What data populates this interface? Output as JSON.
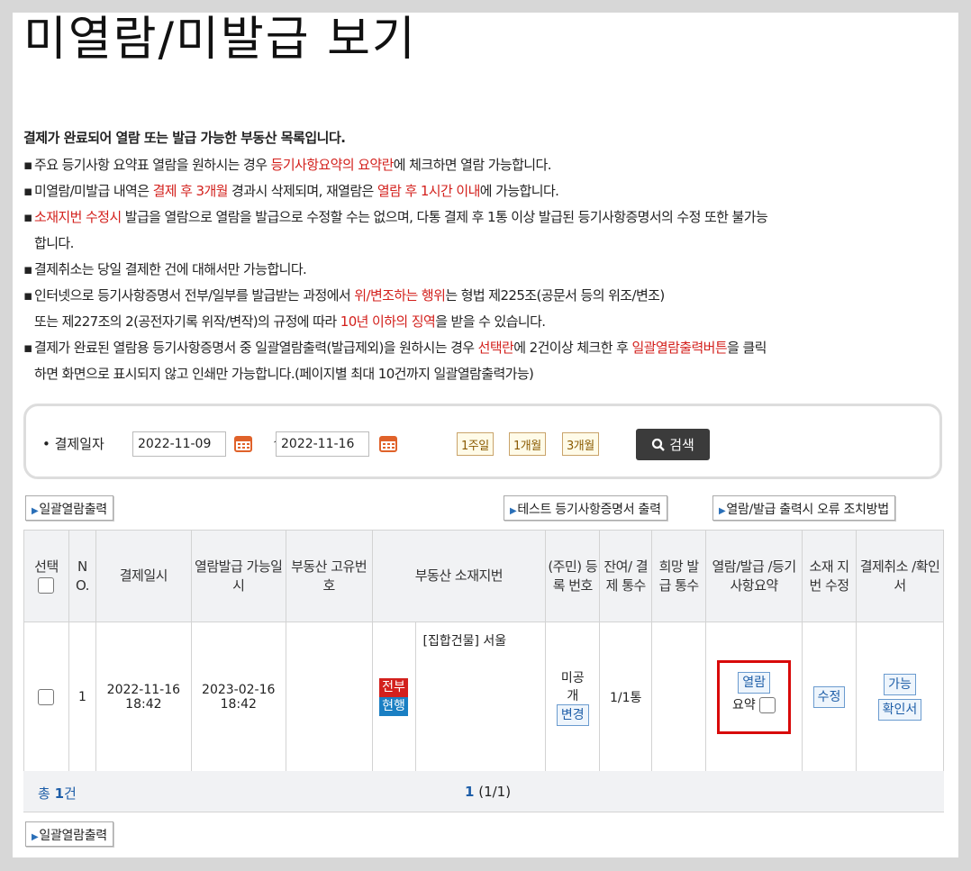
{
  "page_title": "미열람/미발급 보기",
  "notice": {
    "lead": "결제가 완료되어 열람 또는 발급 가능한 부동산 목록입니다.",
    "line1_a": "주요 등기사항 요약표 열람을 원하시는 경우 ",
    "line1_red": "등기사항요약의 요약란",
    "line1_b": "에 체크하면 열람 가능합니다.",
    "line2_a": "미열람/미발급 내역은 ",
    "line2_red1": "결제 후 3개월",
    "line2_b": " 경과시 삭제되며, 재열람은 ",
    "line2_red2": "열람 후 1시간 이내",
    "line2_c": "에 가능합니다.",
    "line3_red": "소재지번 수정시",
    "line3_b": " 발급을 열람으로 열람을 발급으로 수정할 수는 없으며, 다통 결제 후 1통 이상 발급된 등기사항증명서의 수정 또한 불가능",
    "line3_c": "합니다.",
    "line4": "결제취소는 당일 결제한 건에 대해서만 가능합니다.",
    "line5_a": "인터넷으로 등기사항증명서 전부/일부를 발급받는 과정에서 ",
    "line5_red": "위/변조하는 행위",
    "line5_b": "는 형법 제225조(공문서 등의 위조/변조)",
    "line6_a": "또는 제227조의 2(공전자기록 위작/변작)의 규정에 따라 ",
    "line6_red": "10년 이하의 징역",
    "line6_b": "을 받을 수 있습니다.",
    "line7_a": "결제가 완료된 열람용 등기사항증명서 중 일괄열람출력(발급제외)을 원하시는 경우 ",
    "line7_red1": "선택란",
    "line7_b": "에 2건이상 체크한 후 ",
    "line7_red2": "일괄열람출력버튼",
    "line7_c": "을 클릭",
    "line8": "하면 화면으로 표시되지 않고 인쇄만 가능합니다.(페이지별 최대 10건까지 일괄열람출력가능)"
  },
  "search": {
    "label": "• 결제일자",
    "date_from": "2022-11-09",
    "tilde": "~",
    "date_to": "2022-11-16",
    "btn_1week": "1주일",
    "btn_1month": "1개월",
    "btn_3month": "3개월",
    "btn_search": "검색"
  },
  "actions": {
    "bulk_print": "일괄열람출력",
    "test_print": "테스트 등기사항증명서 출력",
    "error_guide": "열람/발급 출력시 오류 조치방법"
  },
  "table": {
    "headers": {
      "select": "선택",
      "no": "N O.",
      "paid_date": "결제일시",
      "available_date": "열람발급 가능일시",
      "unique_no": "부동산 고유번호",
      "address": "부동산 소재지번",
      "resident_no": "(주민) 등록 번호",
      "remaining": "잔여/ 결제 통수",
      "desired": "희망 발급 통수",
      "view_issue": "열람/발급 /등기 사항요약",
      "fix_address": "소재 지번 수정",
      "cancel": "결제취소 /확인서"
    },
    "rows": [
      {
        "no": "1",
        "paid_date": "2022-11-16 18:42",
        "available_date": "2023-02-16 18:42",
        "unique_no": "",
        "badge1": "전부",
        "badge2": "현행",
        "address": "[집합건물] 서울",
        "resident_no": "미공개",
        "resident_change": "변경",
        "remaining": "1/1통",
        "desired": "",
        "view_btn": "열람",
        "summary_label": "요약",
        "fix_btn": "수정",
        "possible_btn": "가능",
        "confirm_btn": "확인서"
      }
    ]
  },
  "footer": {
    "total_prefix": "총",
    "total_count": "1",
    "total_suffix": "건",
    "page_current": "1",
    "page_info": "(1/1)"
  }
}
